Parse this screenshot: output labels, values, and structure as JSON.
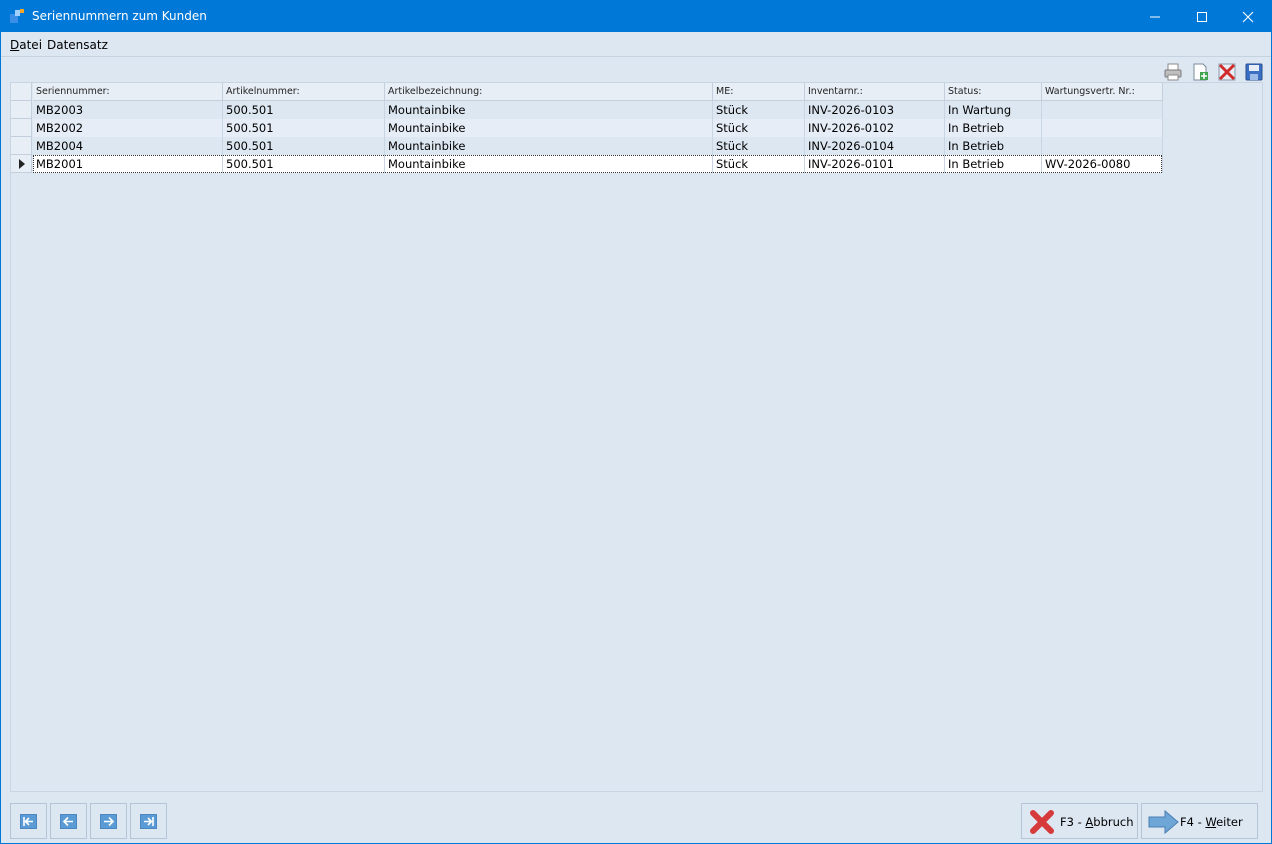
{
  "window": {
    "title": "Seriennummern zum Kunden"
  },
  "menu": {
    "items": [
      {
        "label": "Datei",
        "accel": "D",
        "rest": "atei"
      },
      {
        "label": "Datensatz"
      }
    ]
  },
  "toolbar": {
    "icons": [
      "print-icon",
      "new-record-icon",
      "delete-icon",
      "save-icon"
    ]
  },
  "grid": {
    "columns": [
      "Seriennummer:",
      "Artikelnummer:",
      "Artikelbezeichnung:",
      "ME:",
      "Inventarnr.:",
      "Status:",
      "Wartungsvertr. Nr.:"
    ],
    "rows": [
      [
        "MB2003",
        "500.501",
        "Mountainbike",
        "Stück",
        "INV-2026-0103",
        "In Wartung",
        ""
      ],
      [
        "MB2002",
        "500.501",
        "Mountainbike",
        "Stück",
        "INV-2026-0102",
        "In Betrieb",
        ""
      ],
      [
        "MB2004",
        "500.501",
        "Mountainbike",
        "Stück",
        "INV-2026-0104",
        "In Betrieb",
        ""
      ],
      [
        "MB2001",
        "500.501",
        "Mountainbike",
        "Stück",
        "INV-2026-0101",
        "In Betrieb",
        "WV-2026-0080"
      ]
    ],
    "current_row": 3
  },
  "navigation": {
    "buttons": [
      "first-record",
      "previous-record",
      "next-record",
      "last-record"
    ]
  },
  "actions": {
    "cancel": {
      "prefix": "F3 - ",
      "accel": "A",
      "rest": "bbruch"
    },
    "next": {
      "prefix": "F4 - ",
      "accel": "W",
      "rest": "eiter"
    }
  },
  "colors": {
    "titlebar": "#0078d7",
    "background": "#dde7f2",
    "nav_blue": "#5b9bd5"
  }
}
